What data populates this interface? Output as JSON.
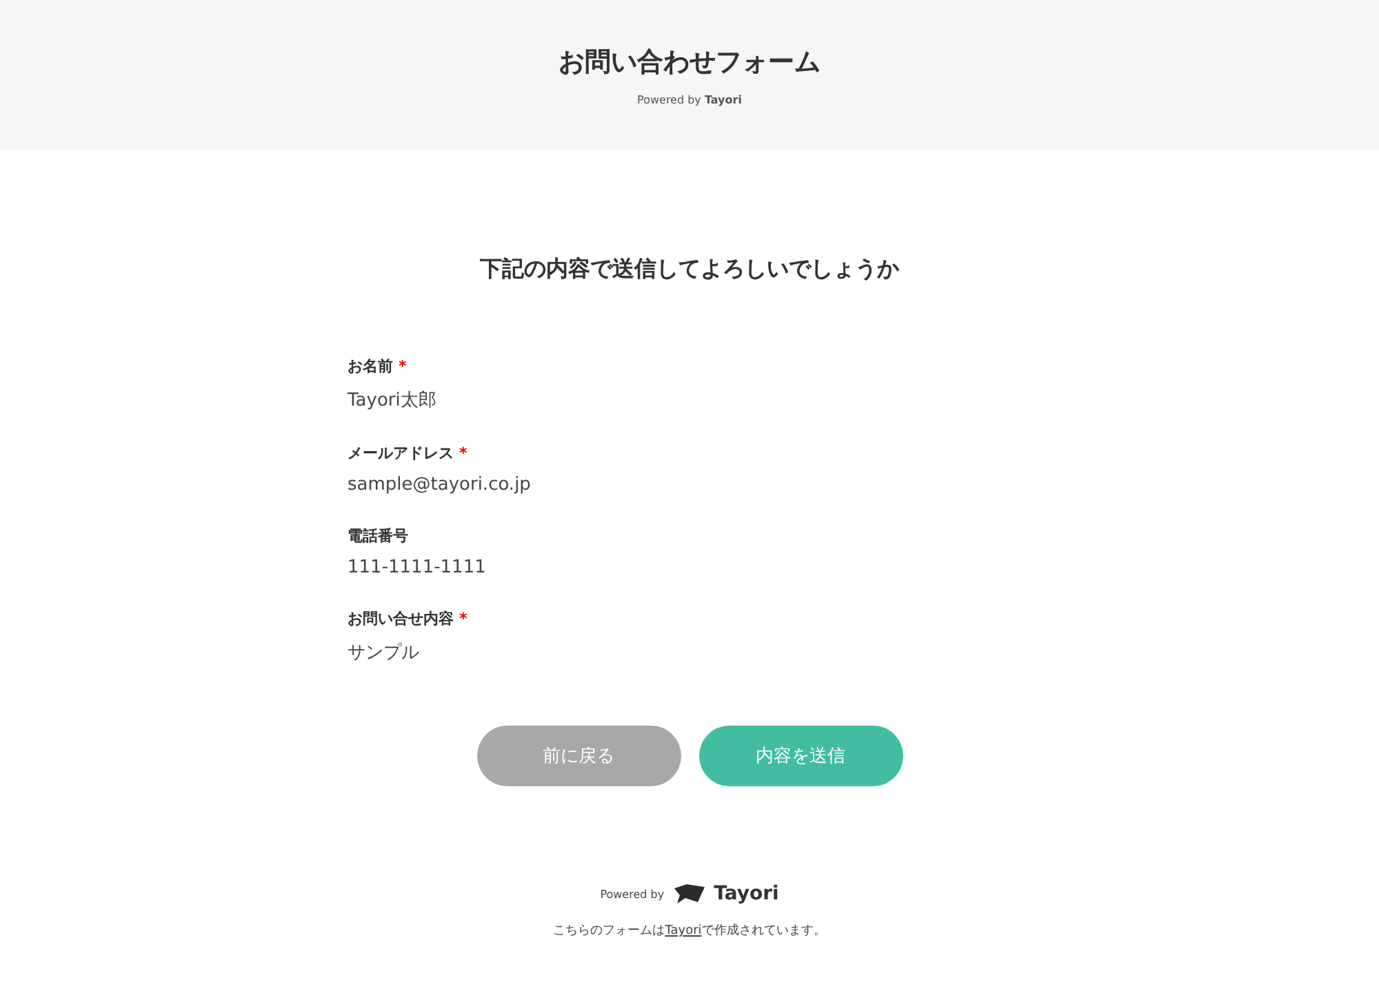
{
  "header": {
    "title": "お問い合わせフォーム",
    "powered_by": "Powered by **Tayori**"
  },
  "confirm_heading": "下記の内容で送信してよろしいでしょうか",
  "required_mark": "*",
  "fields": [
    {
      "label": "お名前",
      "required": true,
      "value": "Tayori太郎"
    },
    {
      "label": "メールアドレス",
      "required": true,
      "value": "sample@tayori.co.jp"
    },
    {
      "label": "電話番号",
      "required": false,
      "value": "111-1111-1111"
    },
    {
      "label": "お問い合せ内容",
      "required": true,
      "value": "サンプル"
    }
  ],
  "buttons": [
    {
      "label": "前に戻る",
      "kind": "back"
    },
    {
      "label": "内容を送信",
      "kind": "submit"
    }
  ],
  "footer": {
    "powered_by": "Powered by",
    "brand": "Tayori",
    "note_before": "こちらのフォームは",
    "note_link": "Tayori",
    "note_after": "で作成されています。"
  }
}
